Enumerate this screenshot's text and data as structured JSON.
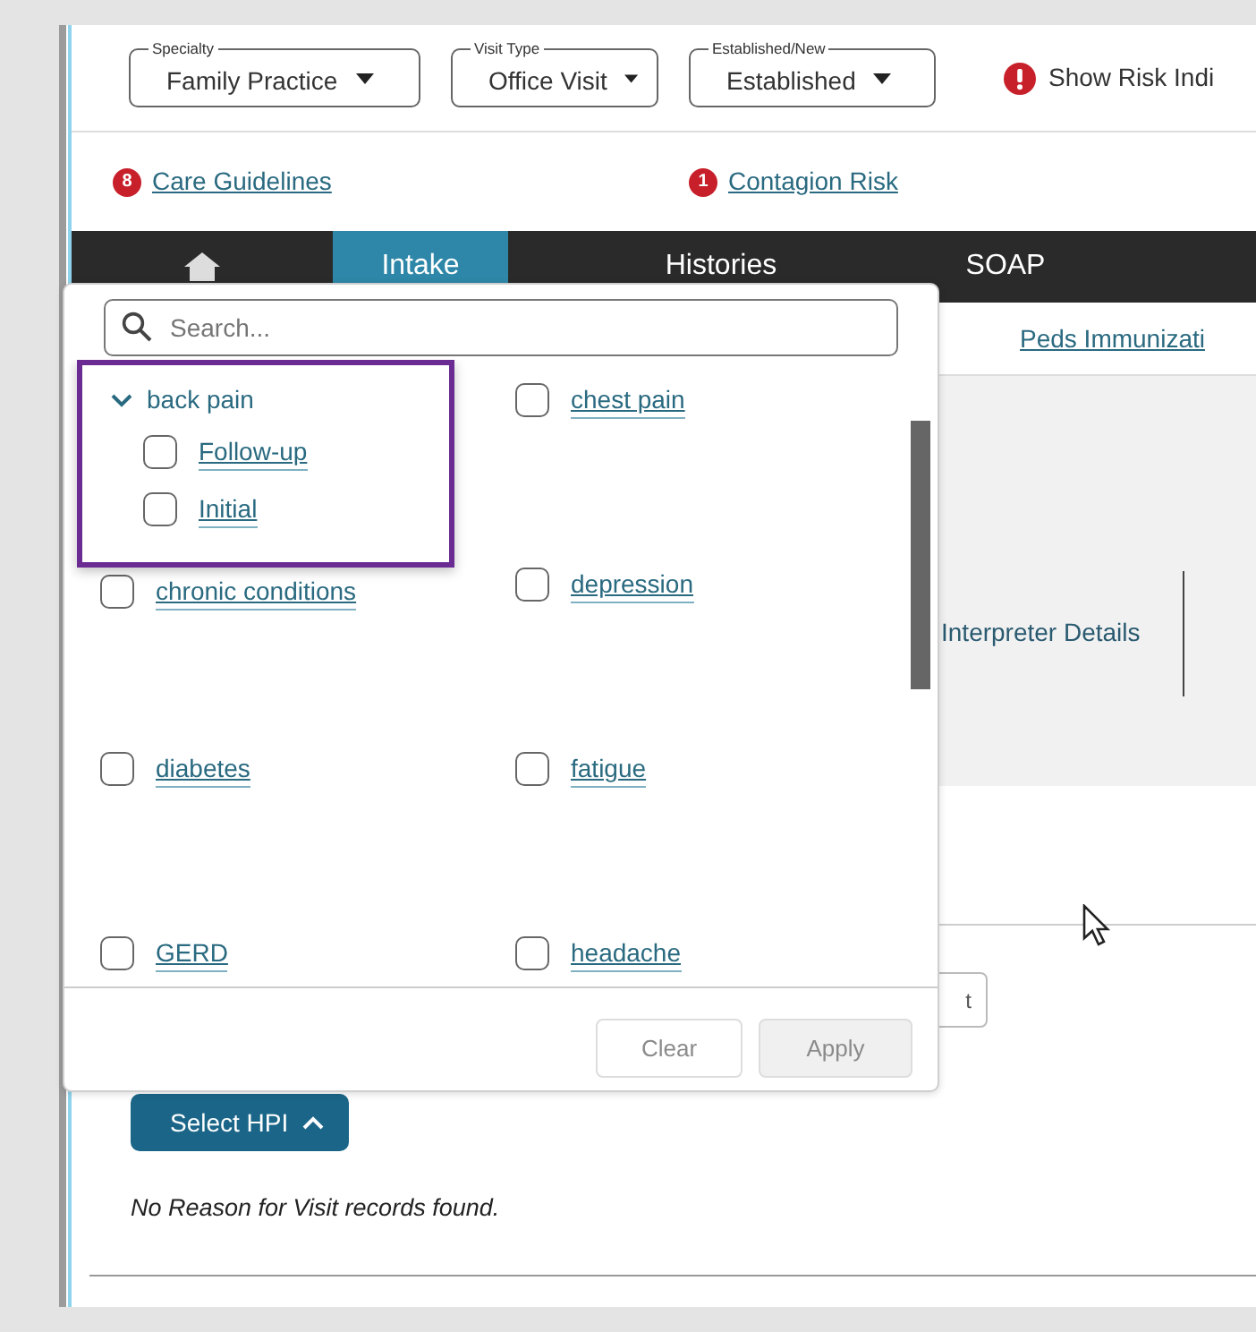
{
  "header": {
    "selects": [
      {
        "label": "Specialty",
        "value": "Family Practice"
      },
      {
        "label": "Visit Type",
        "value": "Office Visit"
      },
      {
        "label": "Established/New",
        "value": "Established"
      }
    ],
    "risk_toggle": {
      "label": "Show Risk Indi"
    }
  },
  "alerts": [
    {
      "count": "8",
      "label": "Care Guidelines"
    },
    {
      "count": "1",
      "label": "Contagion Risk"
    }
  ],
  "nav": {
    "tabs": [
      {
        "label": "Intake",
        "selected": true
      },
      {
        "label": "Histories",
        "selected": false
      },
      {
        "label": "SOAP",
        "selected": false
      }
    ]
  },
  "subnav_link": "Peds Immunizati",
  "interpreter_link": "Interpreter Details",
  "partial_button": "t",
  "select_hpi_button": "Select HPI",
  "empty_message": "No Reason for Visit records found.",
  "hpi_popover": {
    "search": {
      "placeholder": "Search..."
    },
    "items": [
      {
        "kind": "group",
        "label": "back pain",
        "expanded": true,
        "focused": true,
        "children": [
          {
            "label": "Follow-up",
            "checked": false
          },
          {
            "label": "Initial",
            "checked": false
          }
        ]
      },
      {
        "kind": "option",
        "label": "chest pain",
        "checked": false
      },
      {
        "kind": "option",
        "label": "chronic conditions",
        "checked": false
      },
      {
        "kind": "option",
        "label": "depression",
        "checked": false
      },
      {
        "kind": "option",
        "label": "diabetes",
        "checked": false
      },
      {
        "kind": "option",
        "label": "fatigue",
        "checked": false
      },
      {
        "kind": "option",
        "label": "GERD",
        "checked": false
      },
      {
        "kind": "option",
        "label": "headache",
        "checked": false
      }
    ],
    "buttons": [
      {
        "label": "Clear",
        "disabled": true
      },
      {
        "label": "Apply",
        "disabled": true
      }
    ]
  }
}
